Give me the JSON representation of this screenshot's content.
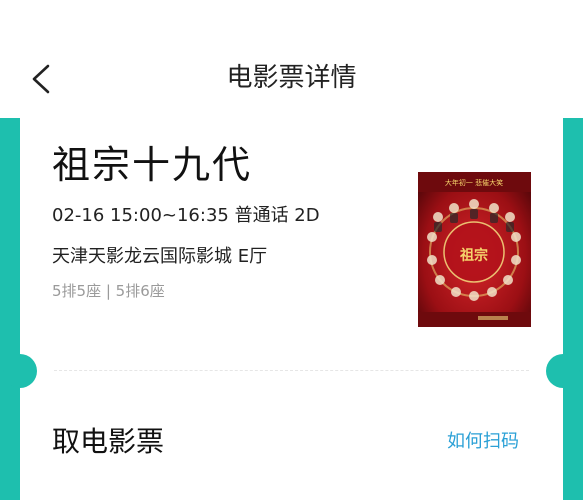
{
  "header": {
    "title": "电影票详情",
    "back_icon": "chevron-left-icon"
  },
  "ticket": {
    "movie_title": "祖宗十九代",
    "showtime": "02-16 15:00~16:35 普通话 2D",
    "cinema": "天津天影龙云国际影城 E厅",
    "seats": "5排5座 | 5排6座",
    "poster": {
      "subject": "movie-poster",
      "tagline": "大年初一 悲催大笑",
      "logo_text": "祖宗十九代"
    }
  },
  "pickup": {
    "title": "取电影票",
    "how_to_scan": "如何扫码"
  },
  "colors": {
    "accent": "#1ebfae",
    "link": "#2aa0d6",
    "poster_red": "#b3121b"
  }
}
